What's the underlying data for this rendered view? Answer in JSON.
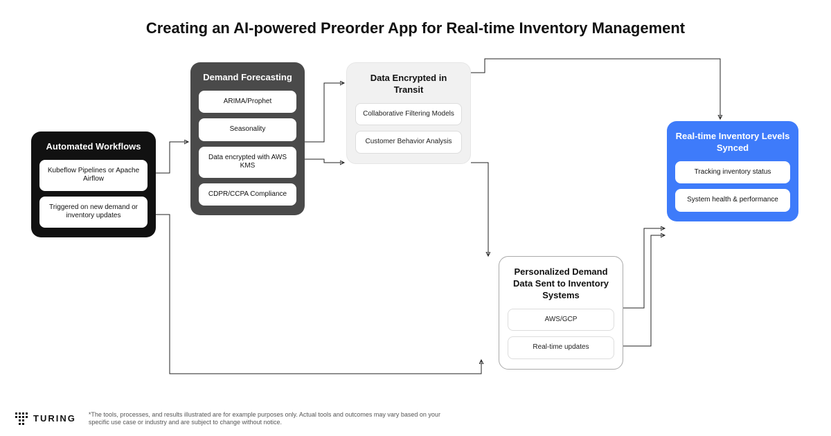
{
  "title": "Creating an AI-powered Preorder App for Real-time Inventory Management",
  "cards": {
    "automated": {
      "title": "Automated Workflows",
      "items": [
        "Kubeflow Pipelines or Apache Airflow",
        "Triggered on new demand or inventory updates"
      ]
    },
    "demand": {
      "title": "Demand Forecasting",
      "items": [
        "ARIMA/Prophet",
        "Seasonality",
        "Data encrypted with AWS KMS",
        "CDPR/CCPA Compliance"
      ]
    },
    "encrypted": {
      "title": "Data Encrypted in Transit",
      "items": [
        "Collaborative Filtering Models",
        "Customer Behavior Analysis"
      ]
    },
    "personalized": {
      "title": "Personalized Demand Data Sent to Inventory Systems",
      "items": [
        "AWS/GCP",
        "Real-time updates"
      ]
    },
    "inventory": {
      "title": "Real-time Inventory Levels Synced",
      "items": [
        "Tracking inventory status",
        "System health & performance"
      ]
    }
  },
  "logo_text": "TURING",
  "disclaimer": "*The tools, processes, and results illustrated are for example purposes only. Actual tools and outcomes may vary based on your specific use case or industry and are subject to change without notice."
}
